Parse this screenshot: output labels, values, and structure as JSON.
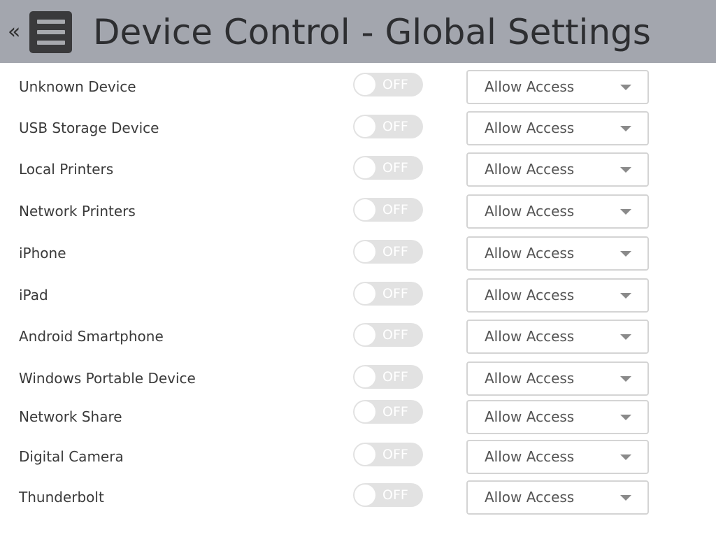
{
  "header": {
    "back_icon": "«",
    "menu_icon": "hamburger-menu-icon",
    "title": "Device Control - Global Settings"
  },
  "devices": [
    {
      "label": "Unknown Device",
      "toggle": "OFF",
      "access": "Allow Access"
    },
    {
      "label": "USB Storage Device",
      "toggle": "OFF",
      "access": "Allow Access"
    },
    {
      "label": "Local Printers",
      "toggle": "OFF",
      "access": "Allow Access"
    },
    {
      "label": "Network Printers",
      "toggle": "OFF",
      "access": "Allow Access"
    },
    {
      "label": "iPhone",
      "toggle": "OFF",
      "access": "Allow Access"
    },
    {
      "label": "iPad",
      "toggle": "OFF",
      "access": "Allow Access"
    },
    {
      "label": "Android Smartphone",
      "toggle": "OFF",
      "access": "Allow Access"
    },
    {
      "label": "Windows Portable Device",
      "toggle": "OFF",
      "access": "Allow Access"
    },
    {
      "label": "Network Share",
      "toggle": "OFF",
      "access": "Allow Access"
    },
    {
      "label": "Digital Camera",
      "toggle": "OFF",
      "access": "Allow Access"
    },
    {
      "label": "Thunderbolt",
      "toggle": "OFF",
      "access": "Allow Access"
    }
  ],
  "colors": {
    "header_bg": "#a3a6ae",
    "title_text": "#2d2e31",
    "toggle_off_bg": "#e2e2e2",
    "select_border": "#d4d4d4"
  }
}
